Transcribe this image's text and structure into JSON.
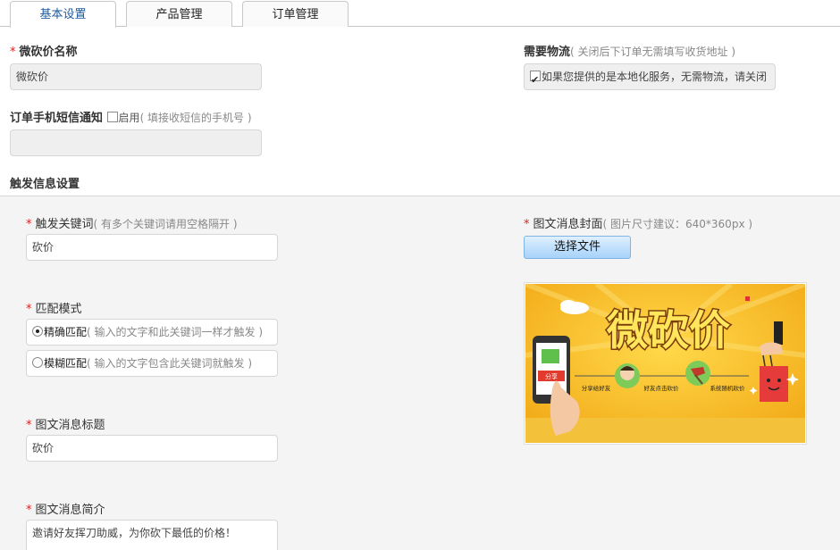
{
  "tabs": [
    "基本设置",
    "产品管理",
    "订单管理"
  ],
  "name_field": {
    "label": "微砍价名称",
    "value": "微砍价"
  },
  "logistics": {
    "label": "需要物流",
    "hint": "( 关闭后下订单无需填写收货地址 )",
    "checkbox_text": "如果您提供的是本地化服务，无需物流，请关闭",
    "checked": true
  },
  "sms": {
    "label": "订单手机短信通知",
    "enable_text": "启用",
    "hint": "( 填接收短信的手机号 )",
    "value": ""
  },
  "trigger_section_title": "触发信息设置",
  "keyword": {
    "label": "触发关键词",
    "hint": "( 有多个关键词请用空格隔开 )",
    "value": "砍价"
  },
  "match_mode": {
    "label": "匹配模式",
    "options": [
      {
        "name": "精确匹配",
        "hint": "( 输入的文字和此关键词一样才触发 )",
        "checked": true
      },
      {
        "name": "模糊匹配",
        "hint": "( 输入的文字包含此关键词就触发 )",
        "checked": false
      }
    ]
  },
  "news_title": {
    "label": "图文消息标题",
    "value": "砍价"
  },
  "news_summary": {
    "label": "图文消息简介",
    "value": "邀请好友挥刀助威，为你砍下最低的价格！"
  },
  "cover": {
    "label": "图文消息封面",
    "hint": "( 图片尺寸建议：640*360px )",
    "button": "选择文件",
    "banner_title": "微砍价",
    "phone_label": "分享",
    "steps": [
      "分享给好友",
      "好友点击砍价",
      "系统随机砍价"
    ]
  },
  "colors": {
    "accent": "#1e5b9e",
    "required": "#e02020",
    "banner_bg": "#f6b81d",
    "banner_title": "#ffe65a"
  }
}
